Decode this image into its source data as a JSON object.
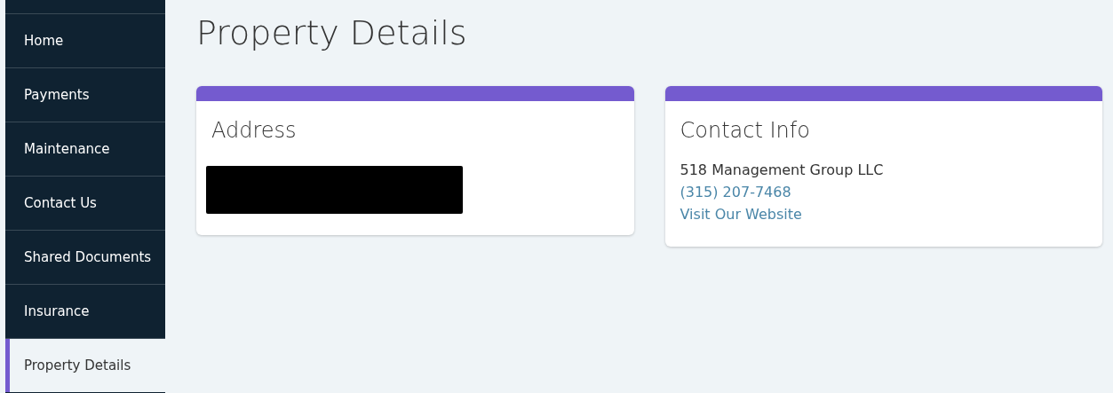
{
  "sidebar": {
    "items": [
      {
        "label": "Home",
        "selected": false
      },
      {
        "label": "Payments",
        "selected": false
      },
      {
        "label": "Maintenance",
        "selected": false
      },
      {
        "label": "Contact Us",
        "selected": false
      },
      {
        "label": "Shared Documents",
        "selected": false
      },
      {
        "label": "Insurance",
        "selected": false
      },
      {
        "label": "Property Details",
        "selected": true
      }
    ]
  },
  "page_title": "Property Details",
  "cards": [
    {
      "kind": "redacted",
      "title": "Address"
    },
    {
      "kind": "contact",
      "title": "Contact Info",
      "company": "518 Management Group LLC",
      "phone": "(315) 207-7468",
      "website_link": "Visit Our Website"
    }
  ]
}
